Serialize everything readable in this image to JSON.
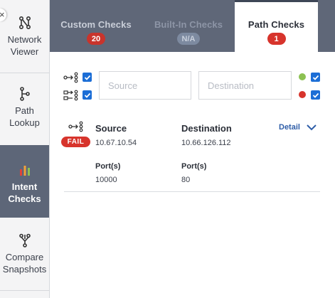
{
  "sidebar": {
    "items": [
      {
        "label_line1": "Network",
        "label_line2": "Viewer",
        "icon": "network-viewer-icon",
        "active": false
      },
      {
        "label_line1": "Path",
        "label_line2": "Lookup",
        "icon": "path-lookup-icon",
        "active": false
      },
      {
        "label_line1": "Intent",
        "label_line2": "Checks",
        "icon": "intent-checks-icon",
        "active": true
      },
      {
        "label_line1": "Compare",
        "label_line2": "Snapshots",
        "icon": "compare-snapshots-icon",
        "active": false
      }
    ],
    "close_glyph": "×"
  },
  "tabs": [
    {
      "label": "Custom Checks",
      "badge": "20",
      "badge_color": "#c9342c",
      "state": "normal"
    },
    {
      "label": "Built-In Checks",
      "badge": "N/A",
      "badge_color": "#7d8aa0",
      "state": "disabled"
    },
    {
      "label": "Path Checks",
      "badge": "1",
      "badge_color": "#d7342c",
      "state": "active"
    }
  ],
  "filters": {
    "source_placeholder": "Source",
    "destination_placeholder": "Destination",
    "pass_color": "#8cc152",
    "fail_color": "#d7342c",
    "checkbox_color": "#1c6ed6"
  },
  "result": {
    "status": "FAIL",
    "status_color": "#d7342c",
    "source_label": "Source",
    "source_ip": "10.67.10.54",
    "destination_label": "Destination",
    "destination_ip": "10.66.126.112",
    "detail_label": "Detail",
    "source_ports_label": "Port(s)",
    "source_ports": "10000",
    "destination_ports_label": "Port(s)",
    "destination_ports": "80"
  }
}
